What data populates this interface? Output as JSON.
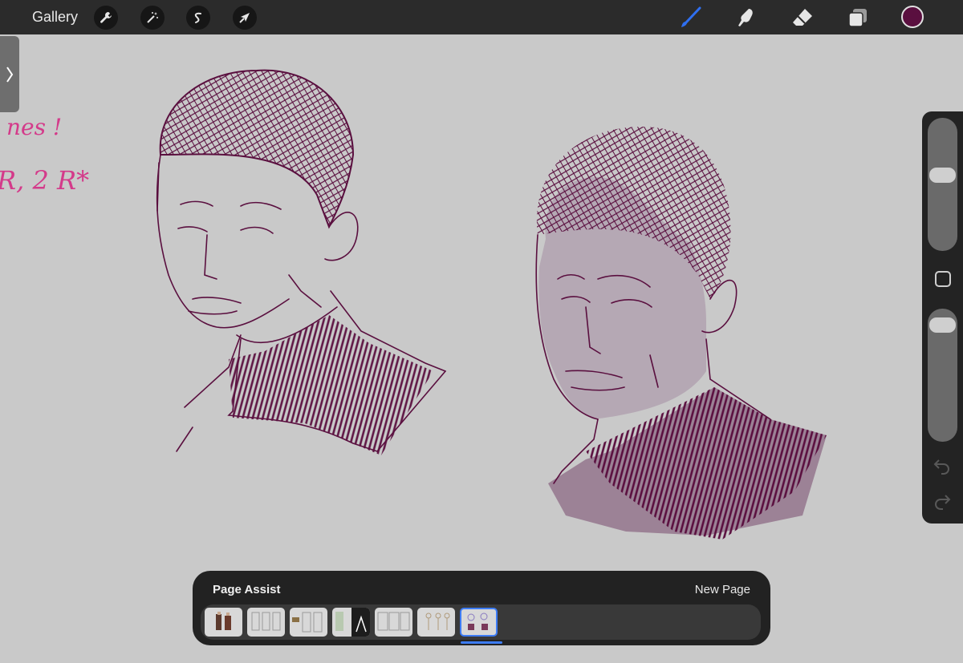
{
  "toolbar": {
    "gallery_label": "Gallery",
    "left_tools": [
      "wrench-icon",
      "magic-wand-icon",
      "selection-icon",
      "move-arrow-icon"
    ],
    "right_tools": [
      "brush-icon",
      "smudge-icon",
      "eraser-icon",
      "layers-icon"
    ],
    "active_tool": "brush-icon",
    "current_color": "#5a0f3f",
    "brush_color": "#2f6ff0"
  },
  "canvas": {
    "handwritten_note_line1": "nes !",
    "handwritten_note_line2": "R, 2 R*",
    "note_color": "#d43a8a",
    "ink_color": "#5a0f3f"
  },
  "sidebar": {
    "brush_size_level": 0.42,
    "opacity_level": 0.06,
    "undo": "undo-icon",
    "redo": "redo-icon"
  },
  "page_assist": {
    "title": "Page Assist",
    "new_page_label": "New Page",
    "page_count": 7,
    "selected_page": 7
  }
}
